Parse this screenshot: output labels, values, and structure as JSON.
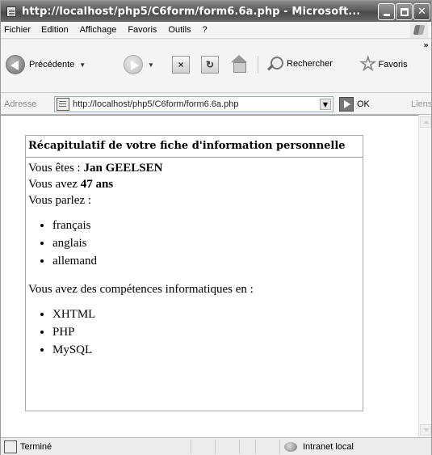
{
  "window": {
    "title": "http://localhost/php5/C6form/form6.6a.php - Microsoft..."
  },
  "menu": {
    "items": [
      "Fichier",
      "Edition",
      "Affichage",
      "Favoris",
      "Outils",
      "?"
    ]
  },
  "toolbar": {
    "back_label": "Précédente",
    "search_label": "Rechercher",
    "favorites_label": "Favoris"
  },
  "address": {
    "label": "Adresse",
    "url": "http://localhost/php5/C6form/form6.6a.php",
    "go_label": "OK",
    "links_label": "Liens"
  },
  "page": {
    "legend": "Récapitulatif de votre fiche d'information personnelle",
    "name_prefix": "Vous êtes : ",
    "name": "Jan GEELSEN",
    "age_prefix": "Vous avez ",
    "age": "47 ans",
    "languages_intro": "Vous parlez :",
    "languages": [
      "français",
      "anglais",
      "allemand"
    ],
    "skills_intro": "Vous avez des compétences informatiques en :",
    "skills": [
      "XHTML",
      "PHP",
      "MySQL"
    ]
  },
  "status": {
    "text": "Terminé",
    "zone": "Intranet local"
  }
}
